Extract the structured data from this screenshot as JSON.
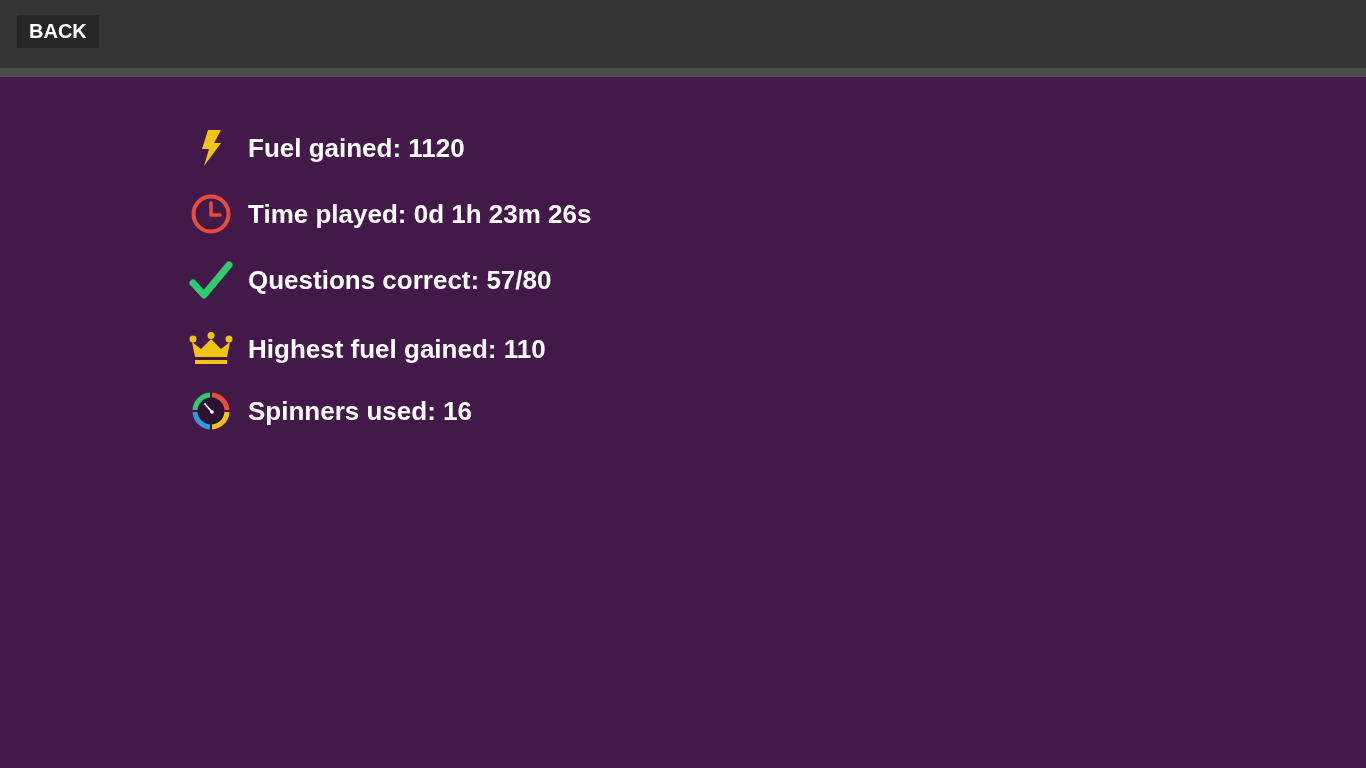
{
  "top_bar": {
    "back_button": "BACK"
  },
  "stats": [
    {
      "kind": "bolt",
      "text": "Fuel gained: 1120"
    },
    {
      "kind": "clock",
      "text": "Time played: 0d 1h 23m 26s"
    },
    {
      "kind": "check",
      "text": "Questions correct: 57/80"
    },
    {
      "kind": "crown",
      "text": "Highest fuel gained: 110"
    },
    {
      "kind": "spinner",
      "text": "Spinners used: 16"
    }
  ]
}
